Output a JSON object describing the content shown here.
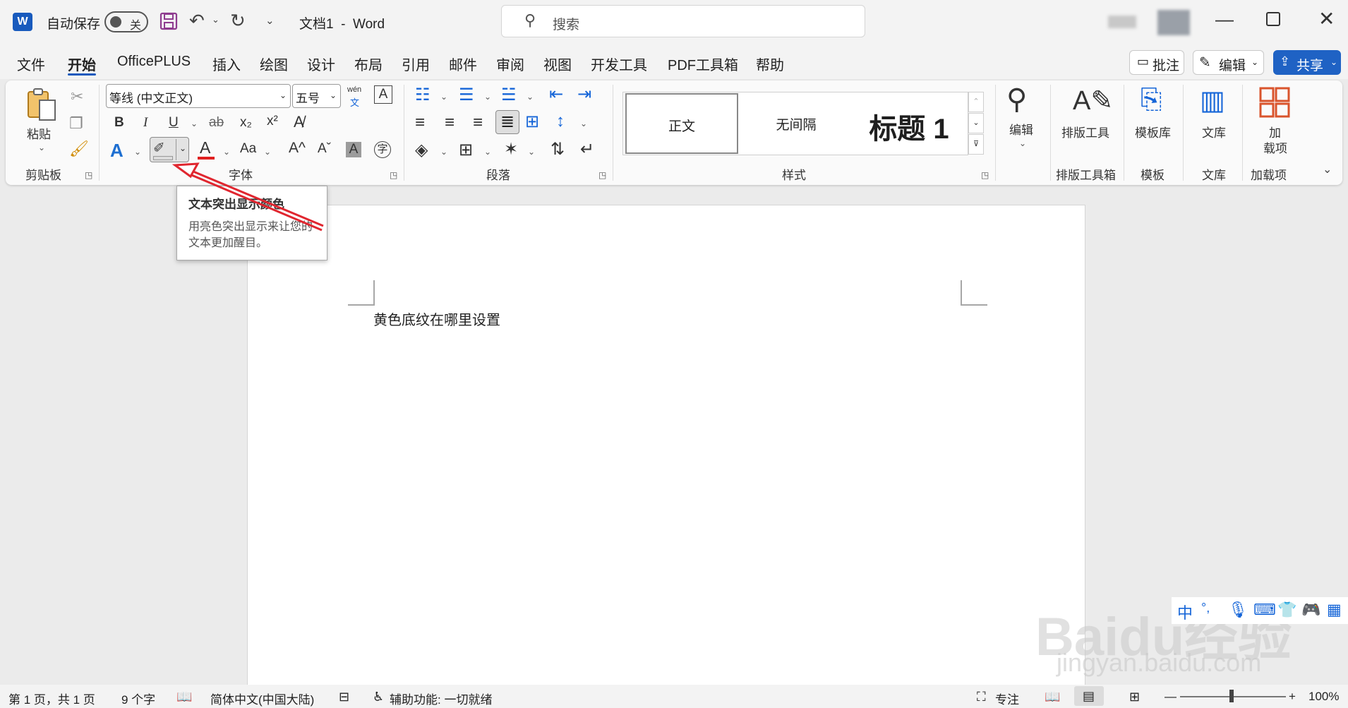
{
  "titlebar": {
    "app_icon": "word-icon",
    "autosave_label": "自动保存",
    "autosave_state": "关",
    "doc_title": "文档1  -  Word",
    "search_placeholder": "搜索",
    "icons": [
      "save-icon",
      "undo-icon",
      "redo-icon",
      "customize-qat-icon",
      "search-icon",
      "minimize-icon",
      "restore-icon",
      "close-icon"
    ]
  },
  "menu": {
    "tabs": [
      "文件",
      "开始",
      "OfficePLUS",
      "插入",
      "绘图",
      "设计",
      "布局",
      "引用",
      "邮件",
      "审阅",
      "视图",
      "开发工具",
      "PDF工具箱",
      "帮助"
    ],
    "active_tab": "开始",
    "comments_label": "批注",
    "editing_label": "编辑",
    "share_label": "共享"
  },
  "ribbon": {
    "clipboard": {
      "label": "剪贴板",
      "paste_label": "粘贴"
    },
    "font": {
      "label": "字体",
      "font_name": "等线 (中文正文)",
      "font_size": "五号",
      "phonetic_top": "wén",
      "phonetic_bottom": "文",
      "bold": "B",
      "italic": "I",
      "underline": "U",
      "strike": "ab",
      "subscript": "x₂",
      "superscript": "x²",
      "effects": "A",
      "font_color": "A",
      "change_case": "Aa",
      "grow": "A^",
      "shrink": "Aˇ",
      "shading": "A",
      "enclose": "字"
    },
    "paragraph": {
      "label": "段落"
    },
    "styles": {
      "label": "样式",
      "items": [
        "正文",
        "无间隔",
        "标题 1"
      ]
    },
    "editing_label": "编辑",
    "typesetting": {
      "button": "排版工具",
      "label": "排版工具箱"
    },
    "templates": {
      "button": "模板库",
      "label": "模板"
    },
    "library": {
      "button": "文库",
      "label": "文库"
    },
    "addins": {
      "button_line1": "加",
      "button_line2": "载项",
      "label": "加载项"
    }
  },
  "tooltip": {
    "title": "文本突出显示颜色",
    "description": "用亮色突出显示来让您的文本更加醒目。"
  },
  "document": {
    "text": "黄色底纹在哪里设置"
  },
  "status": {
    "page": "第 1 页，共 1 页",
    "words": "9 个字",
    "language": "简体中文(中国大陆)",
    "accessibility": "辅助功能: 一切就绪",
    "focus": "专注",
    "zoom": "100%"
  },
  "watermark": {
    "brand": "Baidu经验",
    "url": "jingyan.baidu.com",
    "ime_label": "中"
  },
  "colors": {
    "accent": "#185abd",
    "share_bg": "#1f62c4",
    "arrow": "#e0262f",
    "font_color_bar": "#e02020"
  }
}
